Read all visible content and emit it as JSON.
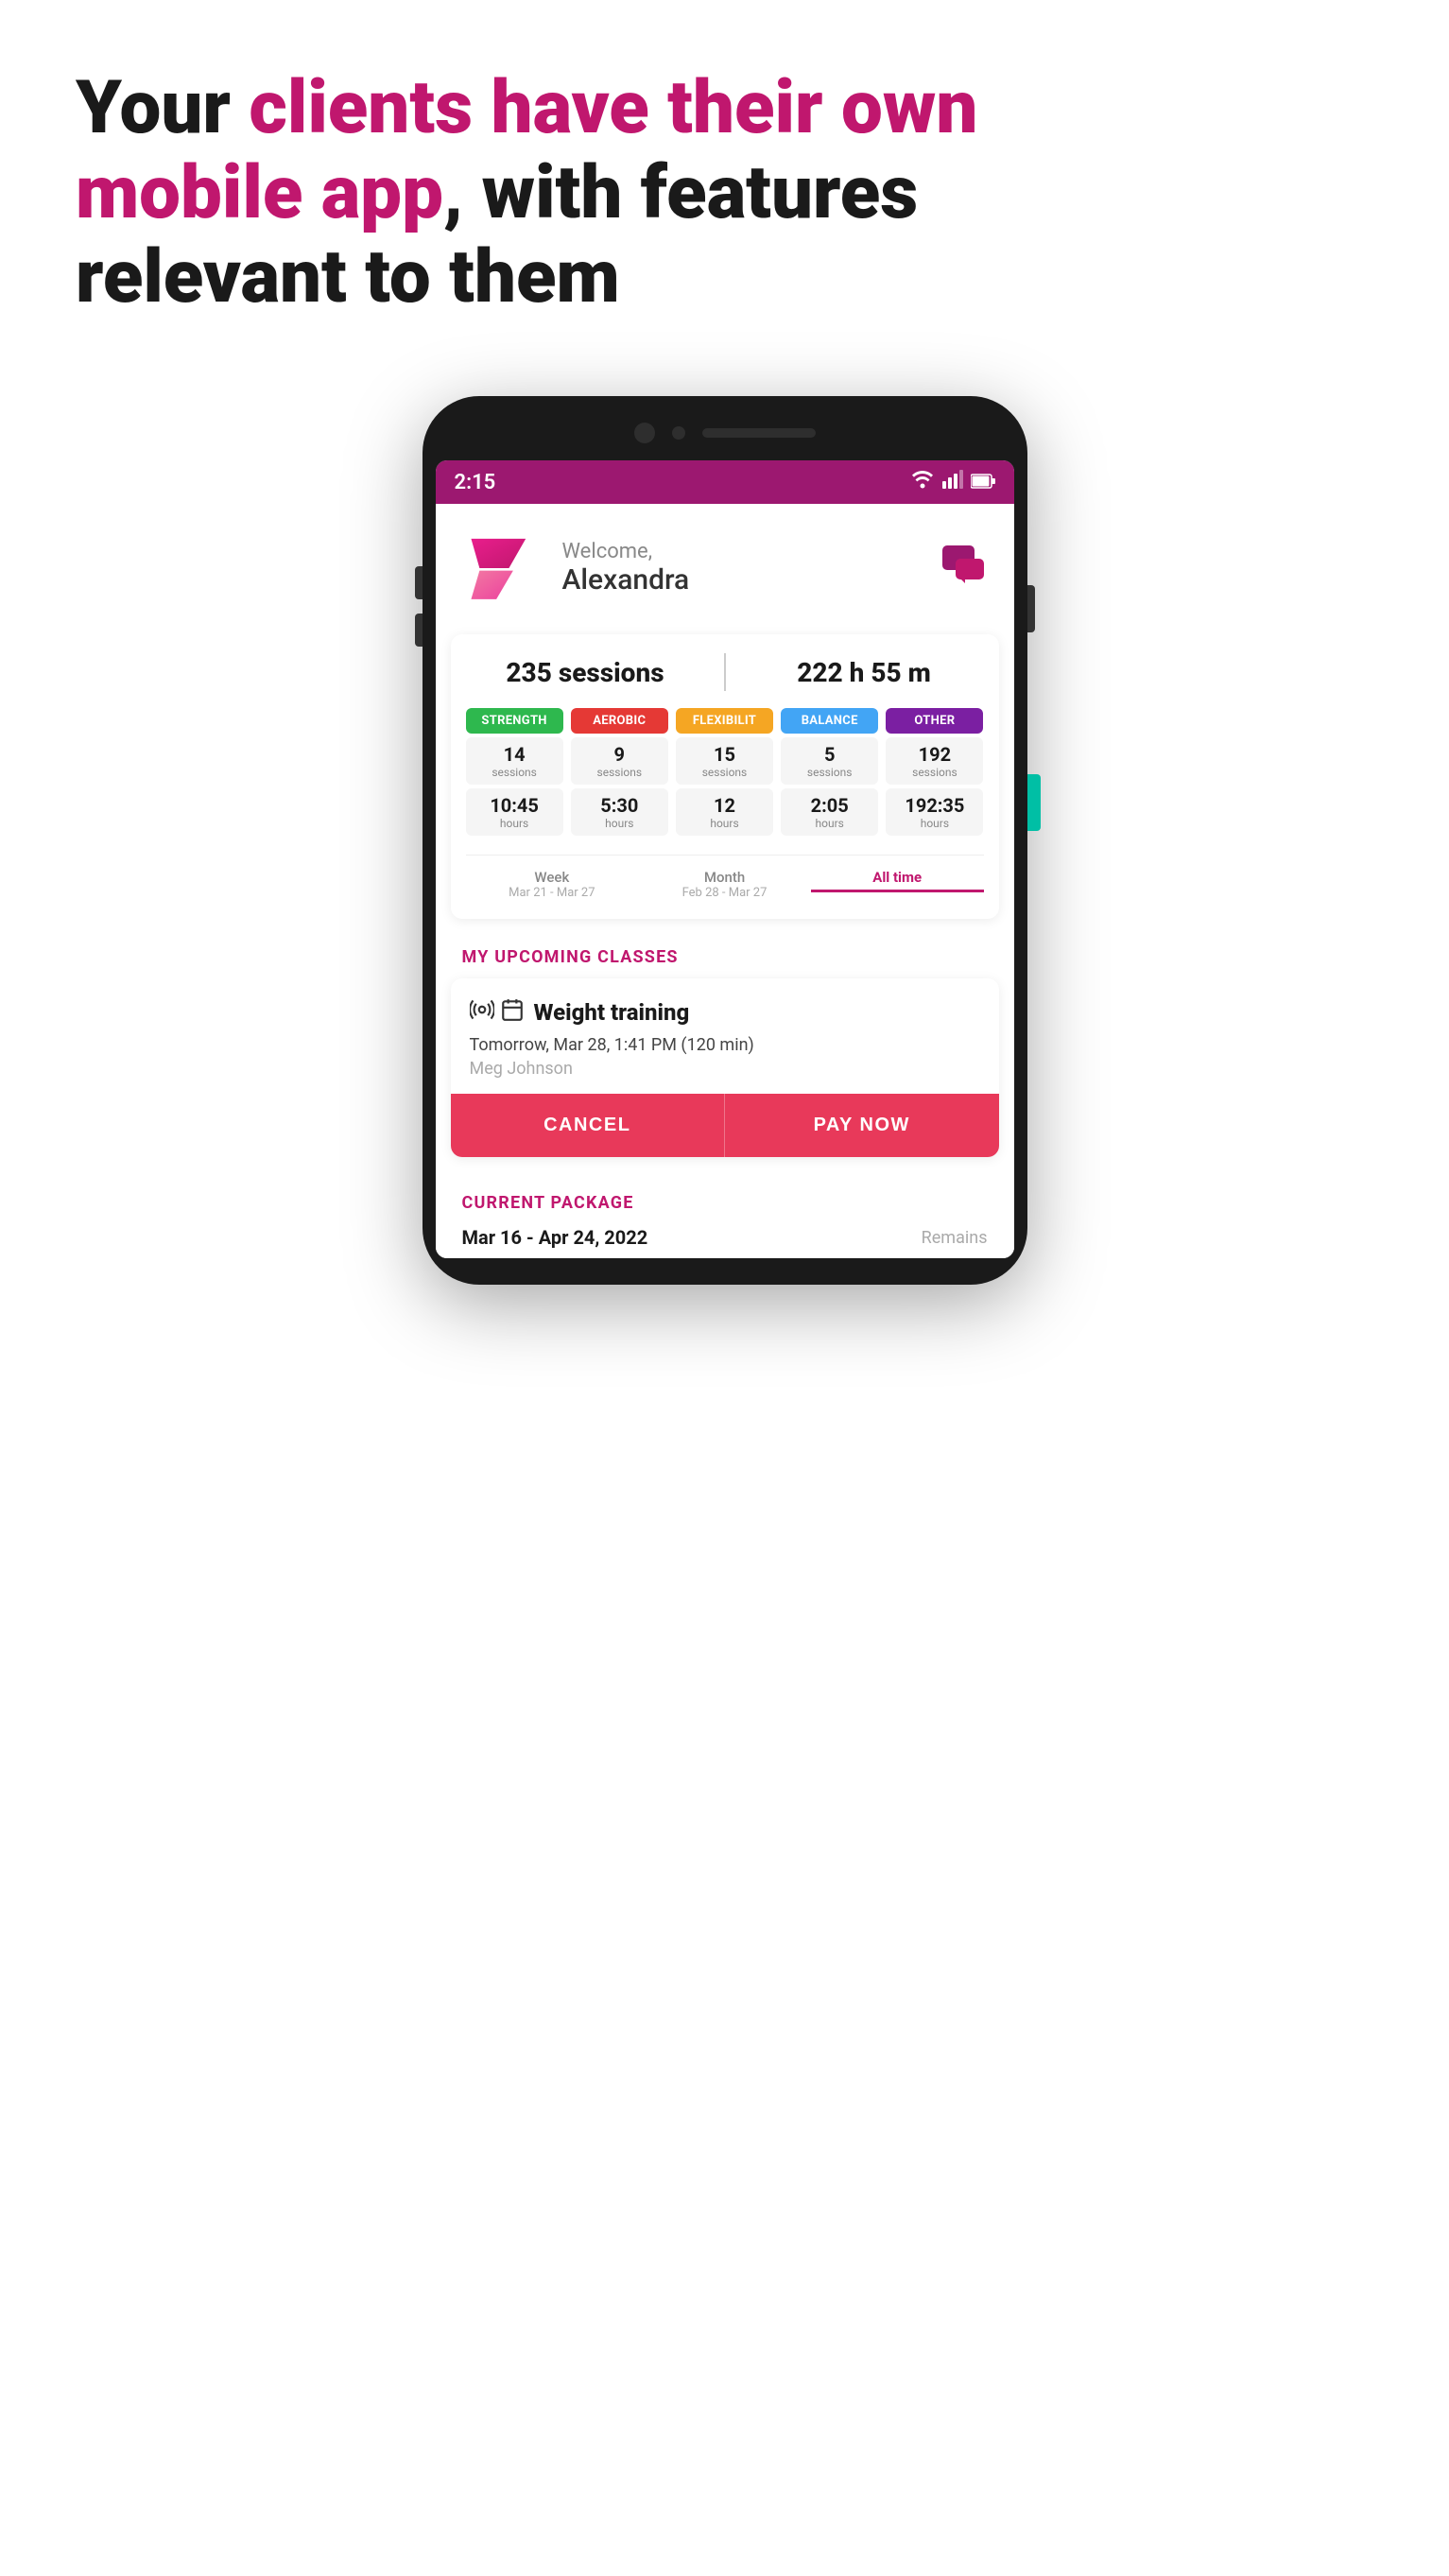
{
  "header": {
    "line1_normal": "Your ",
    "line1_highlight": "clients have their own",
    "line2_highlight": "mobile app",
    "line2_normal": ", with features",
    "line3": "relevant to them"
  },
  "status_bar": {
    "time": "2:15"
  },
  "app_header": {
    "welcome_label": "Welcome,",
    "welcome_name": "Alexandra"
  },
  "stats": {
    "sessions_value": "235 sessions",
    "hours_value": "222 h 55 m",
    "categories": [
      {
        "name": "STRENGTH",
        "badge_class": "badge-strength",
        "sessions": "14",
        "hours": "10:45"
      },
      {
        "name": "AEROBIC",
        "badge_class": "badge-aerobic",
        "sessions": "9",
        "hours": "5:30"
      },
      {
        "name": "FLEXIBILIT",
        "badge_class": "badge-flexibility",
        "sessions": "15",
        "hours": "12"
      },
      {
        "name": "BALANCE",
        "badge_class": "badge-balance",
        "sessions": "5",
        "hours": "2:05"
      },
      {
        "name": "OTHER",
        "badge_class": "badge-other",
        "sessions": "192",
        "hours": "192:35"
      }
    ],
    "time_tabs": [
      {
        "label": "Week",
        "range": "Mar 21 - Mar 27",
        "active": false
      },
      {
        "label": "Month",
        "range": "Feb 28 - Mar 27",
        "active": false
      },
      {
        "label": "All time",
        "range": "",
        "active": true
      }
    ],
    "sessions_sub": "sessions",
    "hours_sub": "hours"
  },
  "upcoming_classes": {
    "section_label": "MY UPCOMING CLASSES",
    "class": {
      "name": "Weight training",
      "datetime": "Tomorrow, Mar 28, 1:41 PM (120 min)",
      "instructor": "Meg Johnson",
      "btn_cancel": "CANCEL",
      "btn_pay": "PAY NOW"
    }
  },
  "current_package": {
    "section_label": "CURRENT PACKAGE",
    "dates": "Mar 16 - Apr 24, 2022",
    "remains_label": "Remains"
  }
}
